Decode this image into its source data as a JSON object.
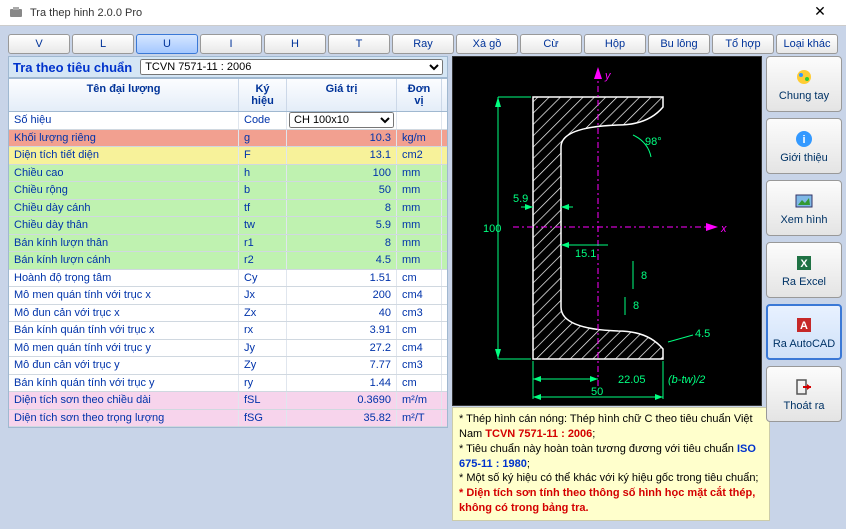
{
  "window": {
    "title": "Tra thep hinh 2.0.0 Pro"
  },
  "tabs": [
    "V",
    "L",
    "U",
    "I",
    "H",
    "T",
    "Ray",
    "Xà gồ",
    "Cừ",
    "Hộp",
    "Bu lông",
    "Tổ hợp",
    "Loại khác"
  ],
  "active_tab": "U",
  "standard": {
    "label": "Tra theo tiêu chuẩn",
    "value": "TCVN 7571-11 : 2006"
  },
  "grid_header": {
    "name": "Tên đại lượng",
    "sym": "Ký hiệu",
    "val": "Giá trị",
    "unit": "Đơn vị"
  },
  "rows": [
    {
      "n": "Số hiệu",
      "s": "Code",
      "v": "CH 100x10",
      "u": "",
      "bg": "#ffffff",
      "select": true
    },
    {
      "n": "Khối lượng riêng",
      "s": "g",
      "v": "10.3",
      "u": "kg/m",
      "bg": "#f2a090"
    },
    {
      "n": "Diện tích tiết diện",
      "s": "F",
      "v": "13.1",
      "u": "cm2",
      "bg": "#f7f29a"
    },
    {
      "n": "Chiều cao",
      "s": "h",
      "v": "100",
      "u": "mm",
      "bg": "#bff2b0"
    },
    {
      "n": "Chiều rộng",
      "s": "b",
      "v": "50",
      "u": "mm",
      "bg": "#bff2b0"
    },
    {
      "n": "Chiều dày cánh",
      "s": "tf",
      "v": "8",
      "u": "mm",
      "bg": "#bff2b0"
    },
    {
      "n": "Chiều dày thân",
      "s": "tw",
      "v": "5.9",
      "u": "mm",
      "bg": "#bff2b0"
    },
    {
      "n": "Bán kính lượn thân",
      "s": "r1",
      "v": "8",
      "u": "mm",
      "bg": "#bff2b0"
    },
    {
      "n": "Bán kính lượn cánh",
      "s": "r2",
      "v": "4.5",
      "u": "mm",
      "bg": "#bff2b0"
    },
    {
      "n": "Hoành độ trọng tâm",
      "s": "Cy",
      "v": "1.51",
      "u": "cm",
      "bg": "#ffffff"
    },
    {
      "n": "Mô men quán tính với trục x",
      "s": "Jx",
      "v": "200",
      "u": "cm4",
      "bg": "#ffffff"
    },
    {
      "n": "Mô đun cản với trục x",
      "s": "Zx",
      "v": "40",
      "u": "cm3",
      "bg": "#ffffff"
    },
    {
      "n": "Bán kính quán tính với trục x",
      "s": "rx",
      "v": "3.91",
      "u": "cm",
      "bg": "#ffffff"
    },
    {
      "n": "Mô men quán tính với trục y",
      "s": "Jy",
      "v": "27.2",
      "u": "cm4",
      "bg": "#ffffff"
    },
    {
      "n": "Mô đun cản với trục y",
      "s": "Zy",
      "v": "7.77",
      "u": "cm3",
      "bg": "#ffffff"
    },
    {
      "n": "Bán kính quán tính với trục y",
      "s": "ry",
      "v": "1.44",
      "u": "cm",
      "bg": "#ffffff"
    },
    {
      "n": "Diện tích sơn theo chiều dài",
      "s": "fSL",
      "v": "0.3690",
      "u": "m²/m",
      "bg": "#f7d4ec"
    },
    {
      "n": "Diện tích sơn theo trọng lượng",
      "s": "fSG",
      "v": "35.82",
      "u": "m²/T",
      "bg": "#f7d4ec"
    }
  ],
  "diagram": {
    "y_axis": "y",
    "x_axis": "x",
    "h": "100",
    "tw": "5.9",
    "angle": "98°",
    "b1": "15.1",
    "tf": "8",
    "r1": "8",
    "r2": "4.5",
    "cy": "22.05",
    "formula": "(b-tw)/2",
    "b": "50"
  },
  "notes": {
    "l1_a": "* Thép hình cán nóng: Thép hình chữ C theo tiêu chuẩn Việt Nam ",
    "l1_b": "TCVN 7571-11 : 2006",
    "l1_c": ";",
    "l2_a": "* Tiêu chuẩn này hoàn toàn tương đương với tiêu chuẩn ",
    "l2_b": "ISO 675-11 : 1980",
    "l2_c": ";",
    "l3": "* Một số ký hiệu có thể khác với ký hiệu gốc trong tiêu chuẩn;",
    "l4": "* Diện tích sơn tính theo thông số hình học mặt cắt thép, không có trong bảng tra."
  },
  "buttons": {
    "b1": "Chung tay",
    "b2": "Giới thiệu",
    "b3": "Xem hình",
    "b4": "Ra Excel",
    "b5": "Ra AutoCAD",
    "b6": "Thoát ra"
  }
}
